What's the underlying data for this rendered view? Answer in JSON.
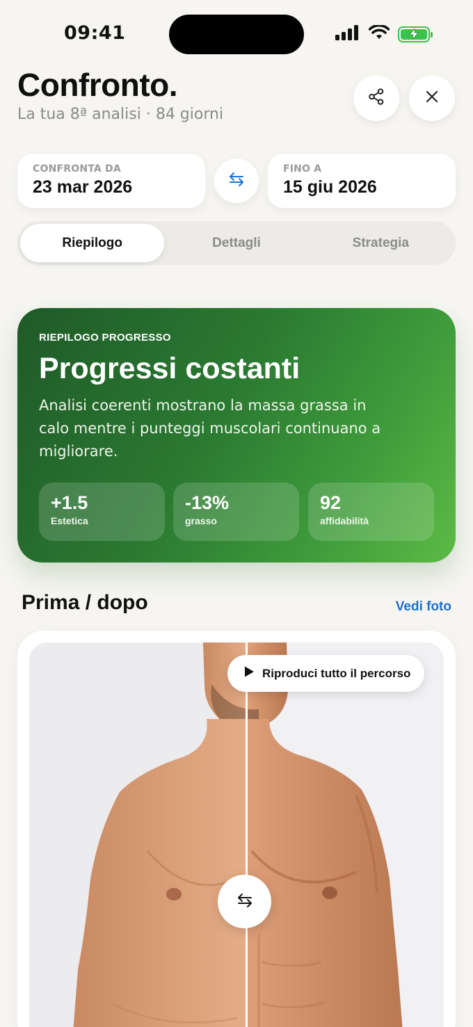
{
  "status_bar": {
    "time": "09:41",
    "icons": [
      "signal-icon",
      "wifi-icon",
      "battery-charging-icon"
    ]
  },
  "header": {
    "title": "Confronto.",
    "subtitle": "La tua 8ª analisi · 84 giorni",
    "share_icon": "share-icon",
    "close_icon": "close-icon"
  },
  "dates": {
    "from_label": "CONFRONTA DA",
    "from_value": "23 mar 2026",
    "to_label": "FINO A",
    "to_value": "15 giu 2026",
    "swap_icon": "swap-arrows-icon"
  },
  "tabs": [
    {
      "label": "Riepilogo",
      "active": true
    },
    {
      "label": "Dettagli",
      "active": false
    },
    {
      "label": "Strategia",
      "active": false
    }
  ],
  "summary": {
    "kicker": "RIEPILOGO PROGRESSO",
    "title": "Progressi costanti",
    "text": "Analisi coerenti mostrano la massa grassa in calo mentre i punteggi muscolari continuano a migliorare.",
    "stats": [
      {
        "value": "+1.5",
        "label": "Estetica"
      },
      {
        "value": "-13%",
        "label": "grasso"
      },
      {
        "value": "92",
        "label": "affidabilità"
      }
    ]
  },
  "before_after": {
    "title": "Prima / dopo",
    "see_photos": "Vedi foto",
    "replay_label": "Riproduci tutto il percorso",
    "play_icon": "play-icon",
    "swap_icon": "swap-arrows-icon"
  },
  "colors": {
    "accent_blue": "#1e6fd0",
    "card_green_dark": "#1f5a28",
    "card_green_light": "#5cbb45",
    "background": "#f6f5f1"
  }
}
